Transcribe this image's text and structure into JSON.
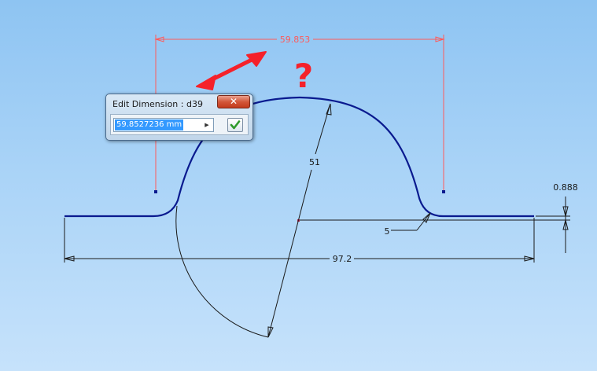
{
  "dialog": {
    "title": "Edit Dimension : d39",
    "close_label": "✕",
    "value": "59.8527236 mm",
    "dropdown_icon": "chevron-right-icon",
    "accept_icon": "checkmark-icon"
  },
  "dimensions": {
    "top_width": "59.853",
    "radius_line": "51",
    "fillet": "5",
    "height_offset": "0.888",
    "overall_width": "97.2"
  },
  "annotations": {
    "question_mark": "?",
    "arrow_icon": "double-arrow-icon"
  },
  "colors": {
    "background_top": "#8ec4f2",
    "background_bottom": "#c6e2fb",
    "profile": "#0a1a8f",
    "dimension_red": "#ff5a5a",
    "annotation_red": "#f5212a",
    "dimension_dark": "#1a1a1a"
  }
}
